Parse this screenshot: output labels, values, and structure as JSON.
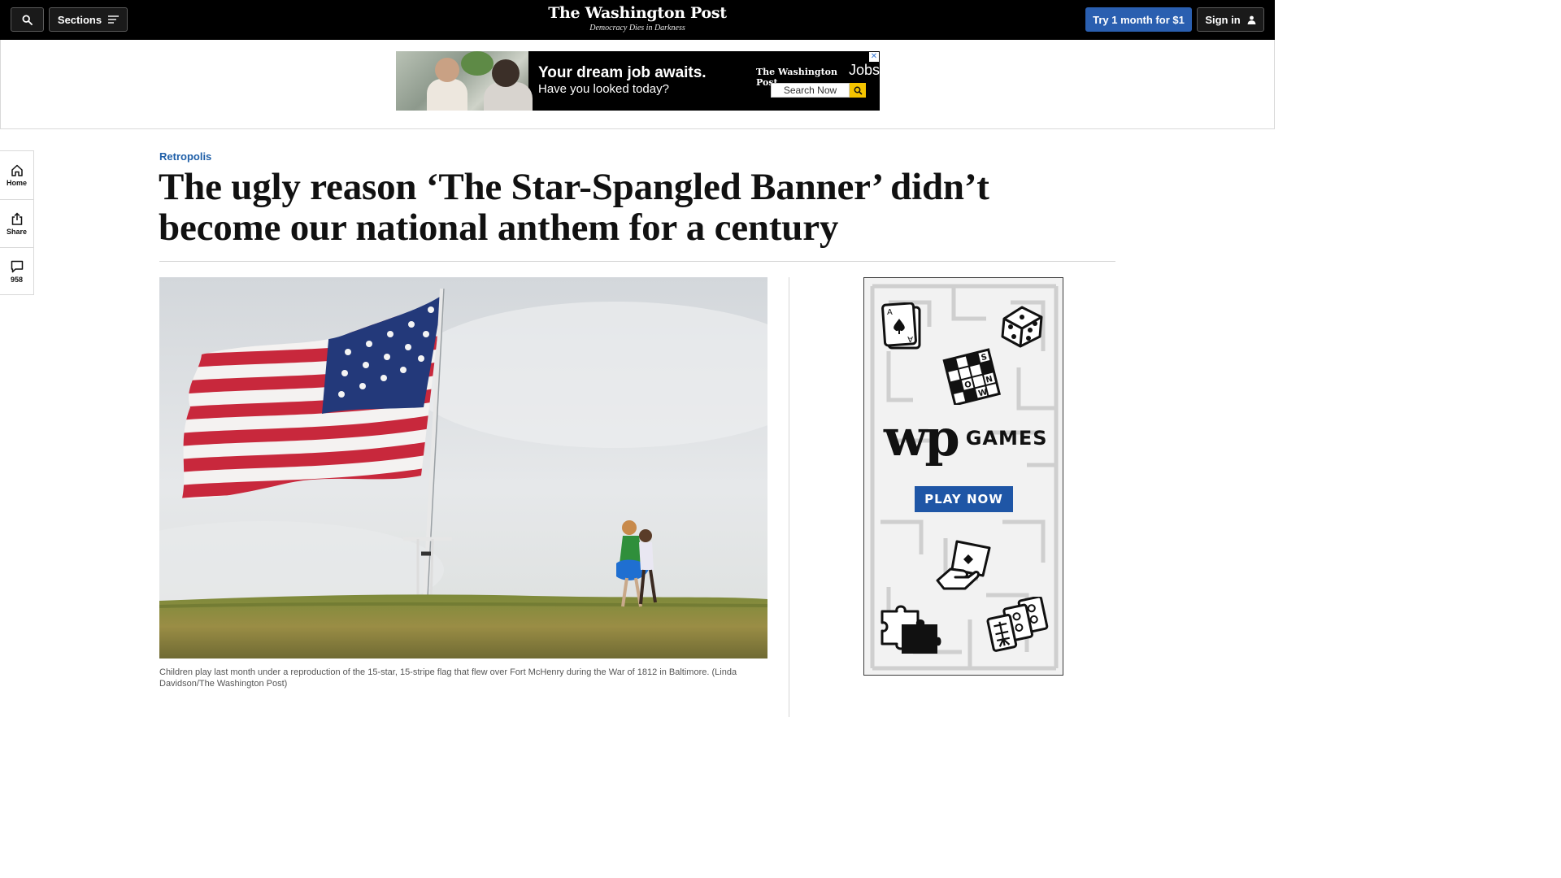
{
  "topbar": {
    "sections_label": "Sections",
    "masthead": "The Washington Post",
    "tagline": "Democracy Dies in Darkness",
    "subscribe_label": "Try 1 month for $1",
    "signin_label": "Sign in"
  },
  "ad_banner": {
    "headline": "Your dream job awaits.",
    "subline": "Have you looked today?",
    "brand": "The Washington Post",
    "brand_product": "Jobs",
    "search_label": "Search Now",
    "close_glyph": "✕"
  },
  "rail": {
    "items": [
      {
        "label": "Home",
        "icon": "home-icon"
      },
      {
        "label": "Share",
        "icon": "share-icon"
      },
      {
        "label": "958",
        "icon": "comment-icon"
      }
    ]
  },
  "article": {
    "kicker": "Retropolis",
    "headline": "The ugly reason ‘The Star-Spangled Banner’ didn’t become our national anthem for a century",
    "caption": "Children play last month under a reproduction of the 15-star, 15-stripe flag that flew over Fort McHenry during the War of 1812 in Baltimore. (Linda Davidson/The Washington Post)"
  },
  "games_ad": {
    "logo": "wp",
    "word": "GAMES",
    "cta": "PLAY NOW",
    "crossword_letters": [
      "S",
      "O",
      "N",
      "W"
    ],
    "card_letters": [
      "A",
      "A"
    ]
  },
  "colors": {
    "accent_blue": "#1f5fa8",
    "subscribe_blue": "#2a5fb0",
    "play_blue": "#1f56a6",
    "flag_red": "#c8283c",
    "flag_blue": "#23397a"
  }
}
